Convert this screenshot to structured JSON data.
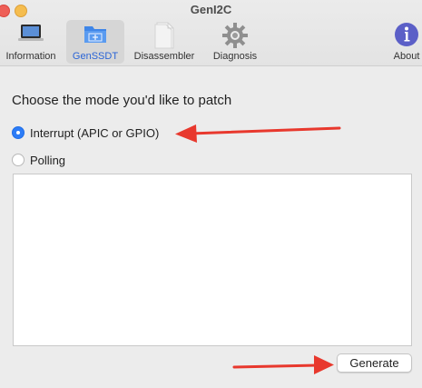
{
  "window": {
    "title": "GenI2C"
  },
  "toolbar": {
    "items": [
      {
        "label": "Information",
        "icon": "laptop-icon",
        "selected": false
      },
      {
        "label": "GenSSDT",
        "icon": "folder-add-icon",
        "selected": true
      },
      {
        "label": "Disassembler",
        "icon": "document-icon",
        "selected": false
      },
      {
        "label": "Diagnosis",
        "icon": "gear-icon",
        "selected": false
      },
      {
        "label": "About",
        "icon": "info-icon",
        "selected": false
      }
    ]
  },
  "main": {
    "heading": "Choose the mode you'd like to patch",
    "options": [
      {
        "label": "Interrupt (APIC or GPIO)",
        "checked": true
      },
      {
        "label": "Polling",
        "checked": false
      }
    ],
    "output_text": "",
    "generate_label": "Generate"
  },
  "colors": {
    "accent": "#2d7cf6",
    "annotation_arrow": "#e8382d"
  }
}
